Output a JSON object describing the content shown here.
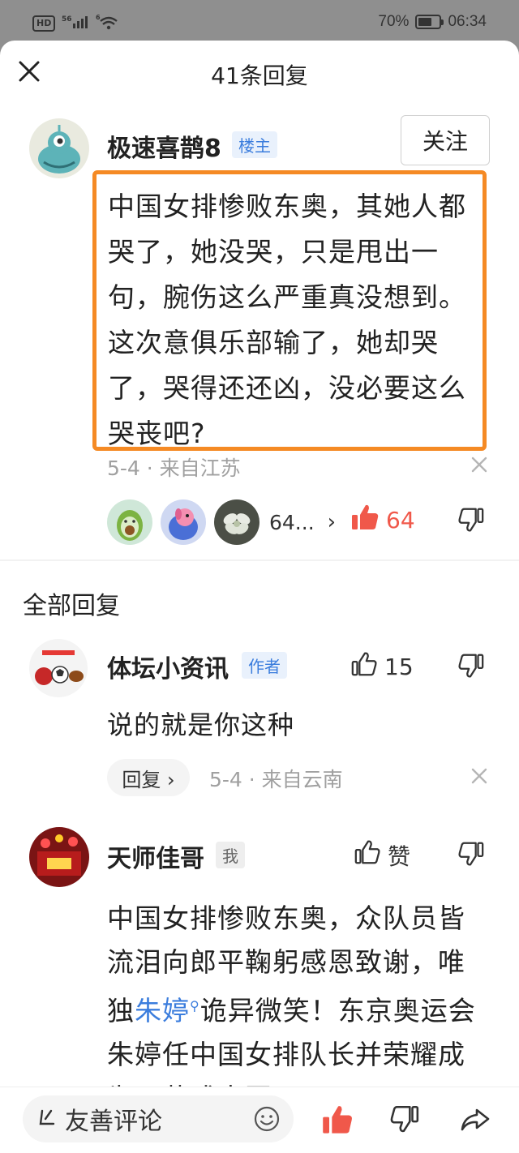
{
  "status_bar": {
    "network": "HD",
    "signal": "56",
    "wifi": "6",
    "battery": "70%",
    "time": "06:34"
  },
  "header": {
    "title": "41条回复"
  },
  "op": {
    "username": "极速喜鹊8",
    "badge": "楼主",
    "follow_label": "关注",
    "content": "中国女排惨败东奥，其她人都哭了，她没哭，只是甩出一句，腕伤这么严重真没想到。这次意俱乐部输了，她却哭了，哭得还还凶，没必要这么哭丧吧?",
    "meta": "5-4 · 来自江苏",
    "likers_count": "64...",
    "like_count": "64"
  },
  "section": {
    "title": "全部回复"
  },
  "comments": [
    {
      "username": "体坛小资讯",
      "badge": "作者",
      "like_count": "15",
      "text": "说的就是你这种",
      "reply_label": "回复 ›",
      "meta": "5-4 · 来自云南"
    },
    {
      "username": "天师佳哥",
      "badge": "我",
      "like_label": "赞",
      "text_part1": "中国女排惨败东奥，众队员皆流泪向郎平鞠躬感恩致谢，唯独",
      "text_link": "朱婷",
      "text_part2": "诡异微笑！东京奥运会朱婷任中国女排队长并荣耀成为开幕式中国"
    }
  ],
  "bottom_bar": {
    "input_placeholder": "友善评论"
  },
  "colors": {
    "accent_orange": "#f58a24",
    "like_red": "#f0584a",
    "link_blue": "#3b7ddd"
  }
}
